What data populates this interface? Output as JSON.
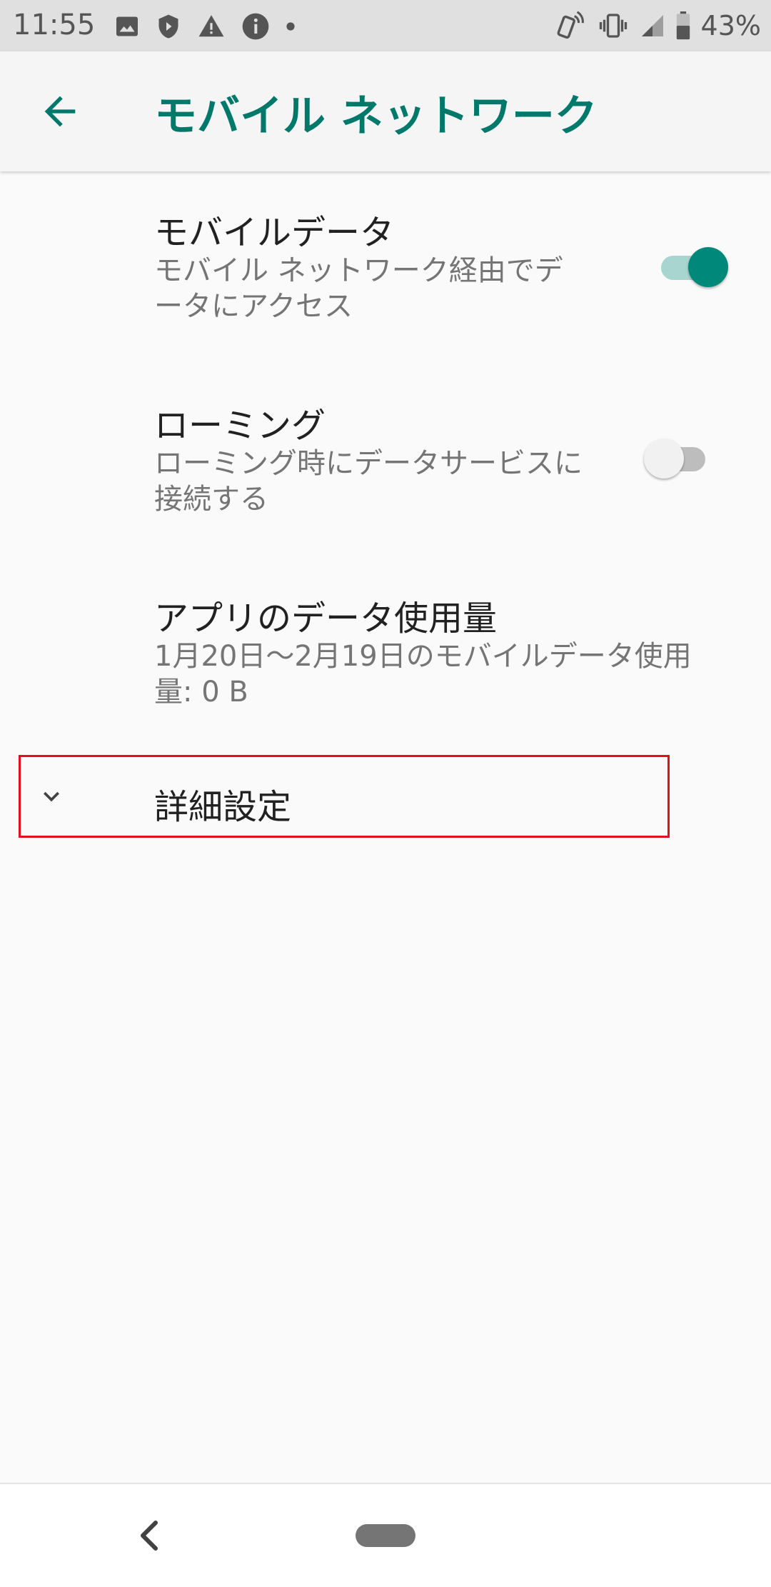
{
  "status_bar": {
    "time": "11:55",
    "battery": "43%",
    "left_icons": [
      "image-icon",
      "shield-icon",
      "warning-icon",
      "info-icon",
      "dot-icon"
    ],
    "right_icons": [
      "nfc-icon",
      "vibrate-icon",
      "signal-icon",
      "battery-icon"
    ]
  },
  "app_bar": {
    "title": "モバイル ネットワーク",
    "back_icon": "arrow-back-icon"
  },
  "preferences": [
    {
      "title": "モバイルデータ",
      "summary": "モバイル ネットワーク経由でデータにアクセス",
      "switch": "on"
    },
    {
      "title": "ローミング",
      "summary": "ローミング時にデータサービスに接続する",
      "switch": "off"
    },
    {
      "title": "アプリのデータ使用量",
      "summary": "1月20日〜2月19日のモバイルデータ使用量: 0 B"
    }
  ],
  "advanced": {
    "label": "詳細設定",
    "icon": "chevron-down-icon",
    "highlight_color": "#e0101f"
  },
  "colors": {
    "accent": "#00796b",
    "switch_on_thumb": "#00897b",
    "switch_on_track": "#a8d5cf"
  },
  "nav_bar": {
    "icons": [
      "nav-back-icon",
      "nav-home-pill"
    ]
  }
}
